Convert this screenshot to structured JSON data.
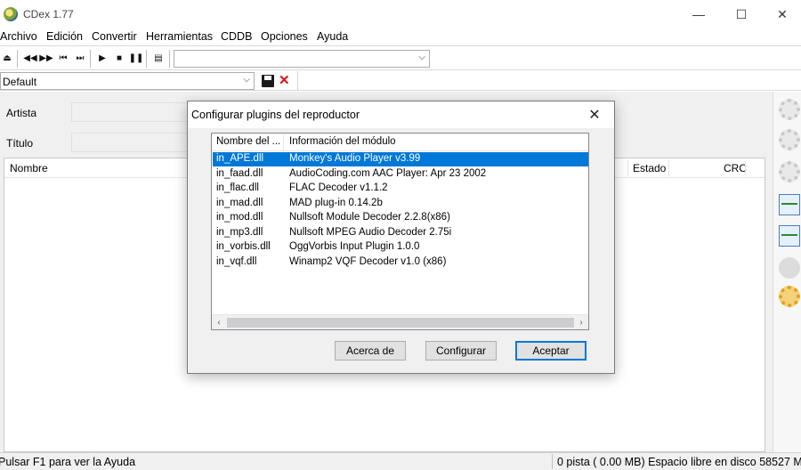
{
  "window": {
    "title": "CDex 1.77",
    "minimize_glyph": "—",
    "maximize_glyph": "☐",
    "close_glyph": "✕"
  },
  "menu": {
    "items": [
      "Archivo",
      "Edición",
      "Convertir",
      "Herramientas",
      "CDDB",
      "Opciones",
      "Ayuda"
    ]
  },
  "toolbar": {
    "buttons": [
      "eject-icon",
      "previous-track-icon",
      "rewind-icon",
      "skip-back-icon",
      "fast-forward-icon",
      "play-icon",
      "stop-icon",
      "pause-icon",
      "cd-info-icon"
    ],
    "track_combo_value": ""
  },
  "profile": {
    "selected": "Default"
  },
  "main": {
    "artist_label": "Artista",
    "title_label": "Título",
    "columns": {
      "name": "Nombre",
      "status": "Estado",
      "crc": "CRC"
    }
  },
  "dialog": {
    "title": "Configurar plugins del reproductor",
    "close_glyph": "✕",
    "columns": {
      "name": "Nombre del ...",
      "info": "Información del módulo"
    },
    "rows": [
      {
        "name": "in_APE.dll",
        "info": "Monkey's Audio Player v3.99",
        "selected": true
      },
      {
        "name": "in_faad.dll",
        "info": "AudioCoding.com AAC Player: Apr 23 2002",
        "selected": false
      },
      {
        "name": "in_flac.dll",
        "info": "FLAC Decoder v1.1.2",
        "selected": false
      },
      {
        "name": "in_mad.dll",
        "info": "MAD plug-in 0.14.2b",
        "selected": false
      },
      {
        "name": "in_mod.dll",
        "info": "Nullsoft Module Decoder 2.2.8(x86)",
        "selected": false
      },
      {
        "name": "in_mp3.dll",
        "info": "Nullsoft MPEG Audio Decoder 2.75i",
        "selected": false
      },
      {
        "name": "in_vorbis.dll",
        "info": "OggVorbis Input Plugin 1.0.0",
        "selected": false
      },
      {
        "name": "in_vqf.dll",
        "info": "Winamp2 VQF Decoder v1.0 (x86)",
        "selected": false
      }
    ],
    "buttons": {
      "about": "Acerca de",
      "configure": "Configurar",
      "accept": "Aceptar"
    }
  },
  "statusbar": {
    "left": "Pulsar F1 para ver la Ayuda",
    "right": "0 pista ( 0.00 MB) Espacio libre en disco 58527 M"
  },
  "colors": {
    "selection": "#0078d7",
    "panel_bg": "#f0f0f0",
    "delete_red": "#dd1111"
  }
}
